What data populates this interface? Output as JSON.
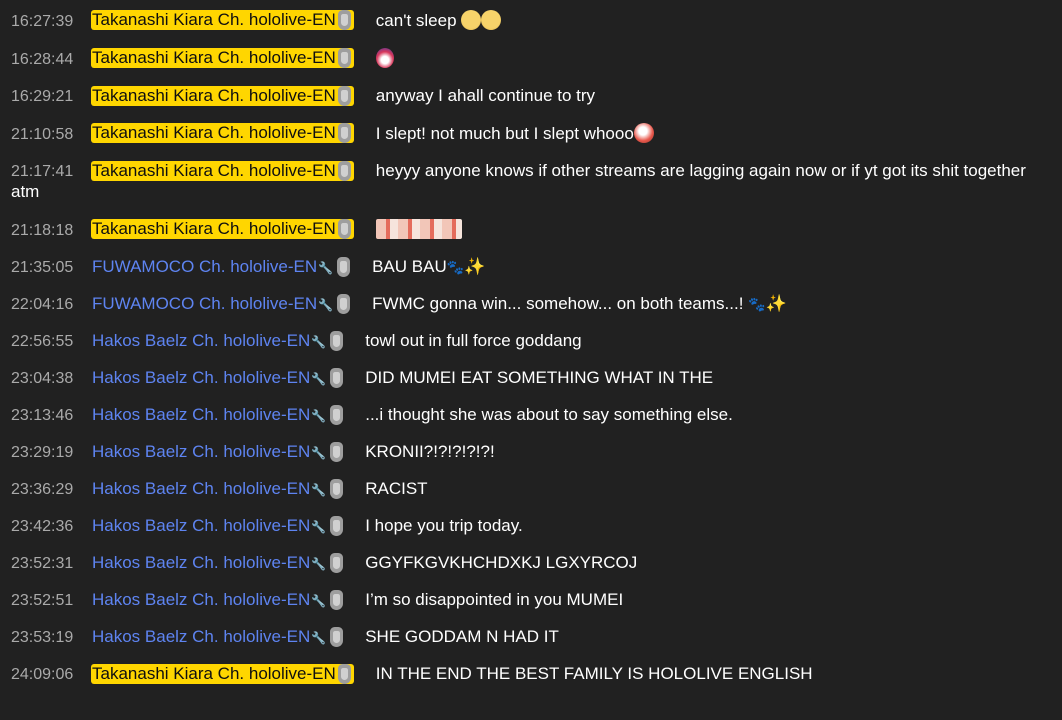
{
  "chat": {
    "colors": {
      "background": "#212121",
      "owner_highlight": "#ffd600",
      "moderator_name": "#5e84f1",
      "timestamp": "#aaaaaa",
      "message_text": "#ffffff"
    },
    "messages": [
      {
        "time": "16:27:39",
        "author": "Takanashi Kiara Ch. hololive-EN",
        "text": "can't sleep",
        "emotes": [
          "sad-face-emote",
          "sad-face-emote"
        ]
      },
      {
        "time": "16:28:44",
        "author": "Takanashi Kiara Ch. hololive-EN",
        "text": "",
        "emotes": [
          "party-emote"
        ]
      },
      {
        "time": "16:29:21",
        "author": "Takanashi Kiara Ch. hololive-EN",
        "text": "anyway I ahall continue to try"
      },
      {
        "time": "21:10:58",
        "author": "Takanashi Kiara Ch. hololive-EN",
        "text": "I slept! not much but I slept whooo",
        "emotes": [
          "kiara-emote"
        ]
      },
      {
        "time": "21:17:41",
        "author": "Takanashi Kiara Ch. hololive-EN",
        "text": "heyyy anyone knows if other streams are lagging again now or if yt got its shit together atm"
      },
      {
        "time": "21:18:18",
        "author": "Takanashi Kiara Ch. hololive-EN",
        "text": "",
        "emotes": [
          "kiara-emote-strip"
        ]
      },
      {
        "time": "21:35:05",
        "author": "FUWAMOCO Ch. hololive-EN",
        "text": "BAU BAU",
        "emotes": [
          "paw-emoji",
          "sparkles-emoji"
        ]
      },
      {
        "time": "22:04:16",
        "author": "FUWAMOCO Ch. hololive-EN",
        "text": "FWMC gonna win... somehow... on both teams...! ",
        "emotes": [
          "paw-emoji",
          "sparkles-emoji"
        ]
      },
      {
        "time": "22:56:55",
        "author": "Hakos Baelz Ch. hololive-EN",
        "text": "towl out in full force goddang"
      },
      {
        "time": "23:04:38",
        "author": "Hakos Baelz Ch. hololive-EN",
        "text": "DID MUMEI EAT SOMETHING WHAT IN THE"
      },
      {
        "time": "23:13:46",
        "author": "Hakos Baelz Ch. hololive-EN",
        "text": "...i thought she was about to say something else."
      },
      {
        "time": "23:29:19",
        "author": "Hakos Baelz Ch. hololive-EN",
        "text": "KRONII?!?!?!?!?!"
      },
      {
        "time": "23:36:29",
        "author": "Hakos Baelz Ch. hololive-EN",
        "text": "RACIST"
      },
      {
        "time": "23:42:36",
        "author": "Hakos Baelz Ch. hololive-EN",
        "text": "I hope you trip today."
      },
      {
        "time": "23:52:31",
        "author": "Hakos Baelz Ch. hololive-EN",
        "text": "GGYFKGVKHCHDXKJ LGXYRCOJ"
      },
      {
        "time": "23:52:51",
        "author": "Hakos Baelz Ch. hololive-EN",
        "text": "I’m so disappointed in you MUMEI"
      },
      {
        "time": "23:53:19",
        "author": "Hakos Baelz Ch. hololive-EN",
        "text": "SHE GODDAM N HAD IT"
      },
      {
        "time": "24:09:06",
        "author": "Takanashi Kiara Ch. hololive-EN",
        "text": "IN THE END THE BEST FAMILY IS HOLOLIVE ENGLISH"
      }
    ]
  }
}
